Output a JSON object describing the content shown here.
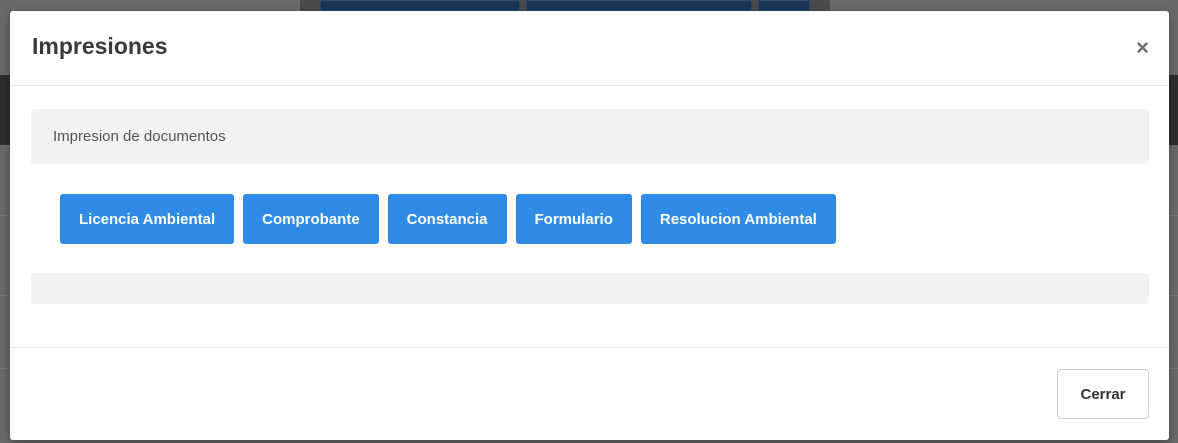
{
  "modal": {
    "title": "Impresiones",
    "close_icon": "close-icon",
    "section_heading": "Impresion de documentos",
    "buttons": [
      "Licencia Ambiental",
      "Comprobante",
      "Constancia",
      "Formulario",
      "Resolucion Ambiental"
    ],
    "close_button_label": "Cerrar"
  },
  "colors": {
    "primary_button": "#2e8be6",
    "panel_bg": "#f2f2f4",
    "overlay": "#5b5b5b"
  }
}
